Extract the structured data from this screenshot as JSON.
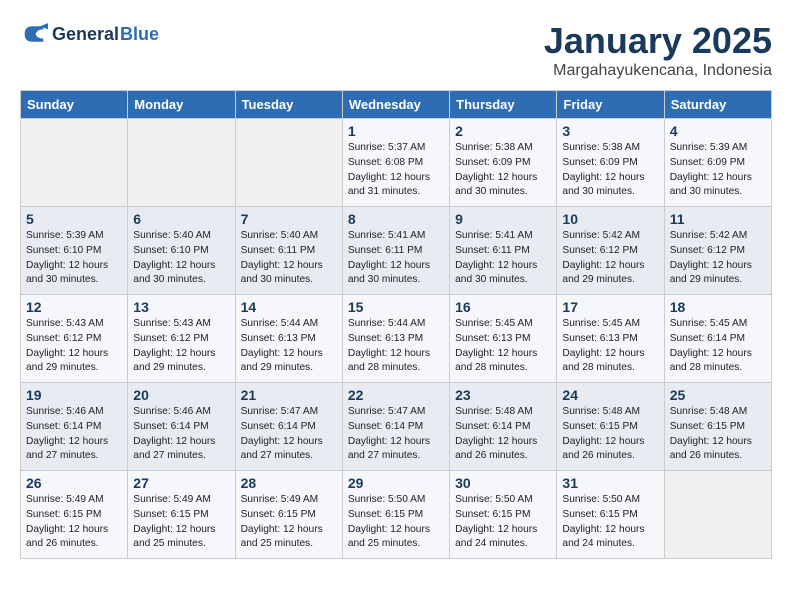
{
  "header": {
    "logo_line1": "General",
    "logo_line2": "Blue",
    "title": "January 2025",
    "subtitle": "Margahayukencana, Indonesia"
  },
  "days_of_week": [
    "Sunday",
    "Monday",
    "Tuesday",
    "Wednesday",
    "Thursday",
    "Friday",
    "Saturday"
  ],
  "weeks": [
    [
      {
        "num": "",
        "info": ""
      },
      {
        "num": "",
        "info": ""
      },
      {
        "num": "",
        "info": ""
      },
      {
        "num": "1",
        "info": "Sunrise: 5:37 AM\nSunset: 6:08 PM\nDaylight: 12 hours\nand 31 minutes."
      },
      {
        "num": "2",
        "info": "Sunrise: 5:38 AM\nSunset: 6:09 PM\nDaylight: 12 hours\nand 30 minutes."
      },
      {
        "num": "3",
        "info": "Sunrise: 5:38 AM\nSunset: 6:09 PM\nDaylight: 12 hours\nand 30 minutes."
      },
      {
        "num": "4",
        "info": "Sunrise: 5:39 AM\nSunset: 6:09 PM\nDaylight: 12 hours\nand 30 minutes."
      }
    ],
    [
      {
        "num": "5",
        "info": "Sunrise: 5:39 AM\nSunset: 6:10 PM\nDaylight: 12 hours\nand 30 minutes."
      },
      {
        "num": "6",
        "info": "Sunrise: 5:40 AM\nSunset: 6:10 PM\nDaylight: 12 hours\nand 30 minutes."
      },
      {
        "num": "7",
        "info": "Sunrise: 5:40 AM\nSunset: 6:11 PM\nDaylight: 12 hours\nand 30 minutes."
      },
      {
        "num": "8",
        "info": "Sunrise: 5:41 AM\nSunset: 6:11 PM\nDaylight: 12 hours\nand 30 minutes."
      },
      {
        "num": "9",
        "info": "Sunrise: 5:41 AM\nSunset: 6:11 PM\nDaylight: 12 hours\nand 30 minutes."
      },
      {
        "num": "10",
        "info": "Sunrise: 5:42 AM\nSunset: 6:12 PM\nDaylight: 12 hours\nand 29 minutes."
      },
      {
        "num": "11",
        "info": "Sunrise: 5:42 AM\nSunset: 6:12 PM\nDaylight: 12 hours\nand 29 minutes."
      }
    ],
    [
      {
        "num": "12",
        "info": "Sunrise: 5:43 AM\nSunset: 6:12 PM\nDaylight: 12 hours\nand 29 minutes."
      },
      {
        "num": "13",
        "info": "Sunrise: 5:43 AM\nSunset: 6:12 PM\nDaylight: 12 hours\nand 29 minutes."
      },
      {
        "num": "14",
        "info": "Sunrise: 5:44 AM\nSunset: 6:13 PM\nDaylight: 12 hours\nand 29 minutes."
      },
      {
        "num": "15",
        "info": "Sunrise: 5:44 AM\nSunset: 6:13 PM\nDaylight: 12 hours\nand 28 minutes."
      },
      {
        "num": "16",
        "info": "Sunrise: 5:45 AM\nSunset: 6:13 PM\nDaylight: 12 hours\nand 28 minutes."
      },
      {
        "num": "17",
        "info": "Sunrise: 5:45 AM\nSunset: 6:13 PM\nDaylight: 12 hours\nand 28 minutes."
      },
      {
        "num": "18",
        "info": "Sunrise: 5:45 AM\nSunset: 6:14 PM\nDaylight: 12 hours\nand 28 minutes."
      }
    ],
    [
      {
        "num": "19",
        "info": "Sunrise: 5:46 AM\nSunset: 6:14 PM\nDaylight: 12 hours\nand 27 minutes."
      },
      {
        "num": "20",
        "info": "Sunrise: 5:46 AM\nSunset: 6:14 PM\nDaylight: 12 hours\nand 27 minutes."
      },
      {
        "num": "21",
        "info": "Sunrise: 5:47 AM\nSunset: 6:14 PM\nDaylight: 12 hours\nand 27 minutes."
      },
      {
        "num": "22",
        "info": "Sunrise: 5:47 AM\nSunset: 6:14 PM\nDaylight: 12 hours\nand 27 minutes."
      },
      {
        "num": "23",
        "info": "Sunrise: 5:48 AM\nSunset: 6:14 PM\nDaylight: 12 hours\nand 26 minutes."
      },
      {
        "num": "24",
        "info": "Sunrise: 5:48 AM\nSunset: 6:15 PM\nDaylight: 12 hours\nand 26 minutes."
      },
      {
        "num": "25",
        "info": "Sunrise: 5:48 AM\nSunset: 6:15 PM\nDaylight: 12 hours\nand 26 minutes."
      }
    ],
    [
      {
        "num": "26",
        "info": "Sunrise: 5:49 AM\nSunset: 6:15 PM\nDaylight: 12 hours\nand 26 minutes."
      },
      {
        "num": "27",
        "info": "Sunrise: 5:49 AM\nSunset: 6:15 PM\nDaylight: 12 hours\nand 25 minutes."
      },
      {
        "num": "28",
        "info": "Sunrise: 5:49 AM\nSunset: 6:15 PM\nDaylight: 12 hours\nand 25 minutes."
      },
      {
        "num": "29",
        "info": "Sunrise: 5:50 AM\nSunset: 6:15 PM\nDaylight: 12 hours\nand 25 minutes."
      },
      {
        "num": "30",
        "info": "Sunrise: 5:50 AM\nSunset: 6:15 PM\nDaylight: 12 hours\nand 24 minutes."
      },
      {
        "num": "31",
        "info": "Sunrise: 5:50 AM\nSunset: 6:15 PM\nDaylight: 12 hours\nand 24 minutes."
      },
      {
        "num": "",
        "info": ""
      }
    ]
  ]
}
